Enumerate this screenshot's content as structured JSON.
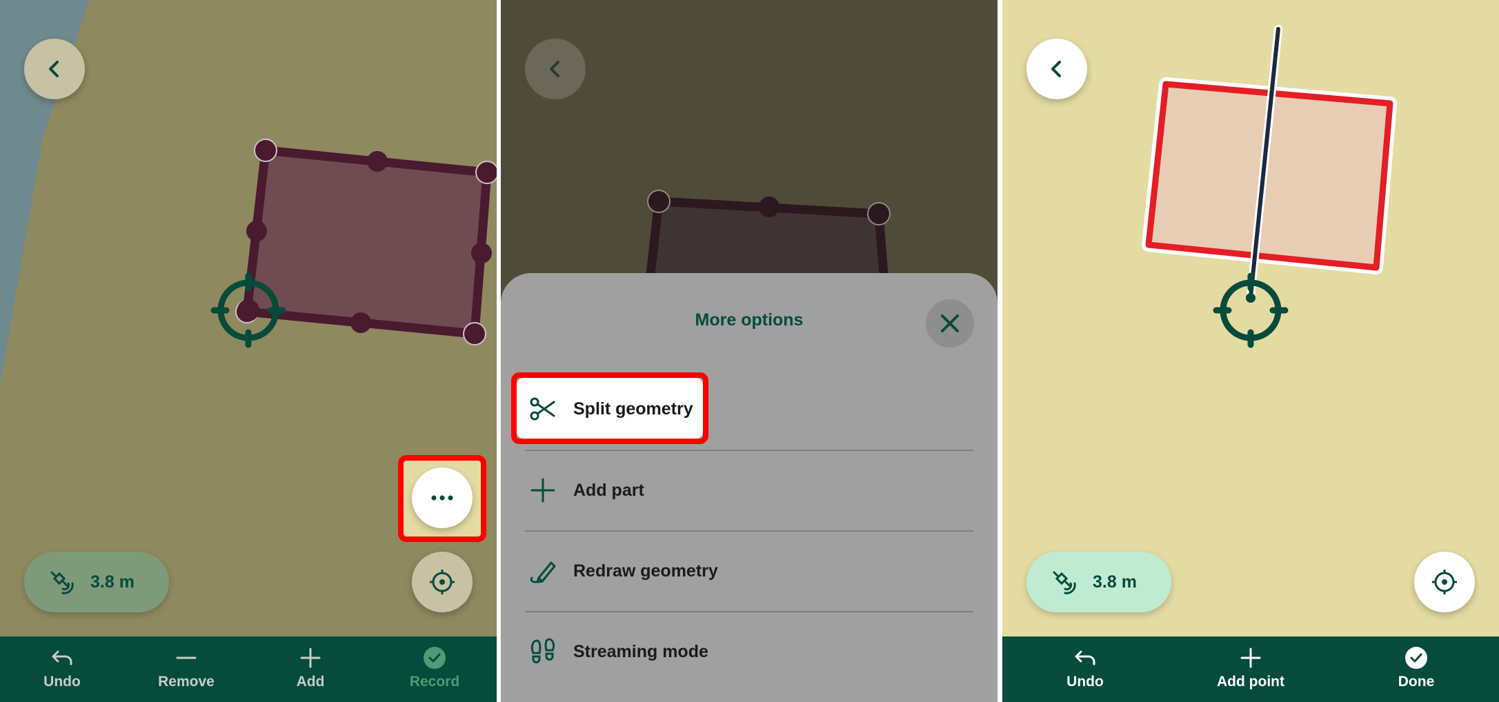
{
  "screens": [
    {
      "gps_accuracy": "3.8 m",
      "bottom_bar": [
        {
          "label": "Undo",
          "icon": "undo-icon"
        },
        {
          "label": "Remove",
          "icon": "minus-icon"
        },
        {
          "label": "Add",
          "icon": "plus-icon"
        },
        {
          "label": "Record",
          "icon": "check-circle-icon"
        }
      ]
    },
    {
      "sheet": {
        "title": "More options",
        "options": [
          {
            "label": "Split geometry",
            "icon": "scissors-icon"
          },
          {
            "label": "Add part",
            "icon": "plus-icon"
          },
          {
            "label": "Redraw geometry",
            "icon": "pen-icon"
          },
          {
            "label": "Streaming mode",
            "icon": "footprints-icon"
          }
        ]
      }
    },
    {
      "gps_accuracy": "3.8 m",
      "bottom_bar": [
        {
          "label": "Undo",
          "icon": "undo-icon"
        },
        {
          "label": "Add point",
          "icon": "plus-icon"
        },
        {
          "label": "Done",
          "icon": "check-circle-icon"
        }
      ]
    }
  ],
  "colors": {
    "primary": "#064b3b",
    "highlight": "#ff0000",
    "polygon_vertex": "#4a1a2f",
    "split_polygon_outline": "#e31e24",
    "gps_chip_active": "#c0ebd3",
    "record_disabled": "#4f9a77"
  }
}
